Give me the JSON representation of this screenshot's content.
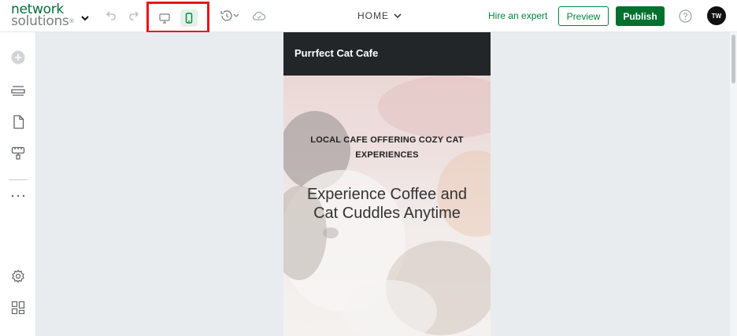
{
  "brand": {
    "logo_line1": "network",
    "logo_line2": "solutions",
    "logo_reg": "®"
  },
  "toolbar": {
    "page_name": "HOME",
    "hire_label": "Hire an expert",
    "preview_label": "Preview",
    "publish_label": "Publish",
    "avatar_initials": "TW",
    "device_mode": "mobile"
  },
  "site": {
    "title": "Purrfect Cat Cafe",
    "hero_kicker": "LOCAL CAFE OFFERING COZY CAT EXPERIENCES",
    "hero_heading": "Experience Coffee and Cat Cuddles Anytime"
  },
  "colors": {
    "brand_green": "#00853f",
    "publish_green": "#00702f",
    "highlight_red": "#e8141b",
    "header_dark": "#232629"
  }
}
